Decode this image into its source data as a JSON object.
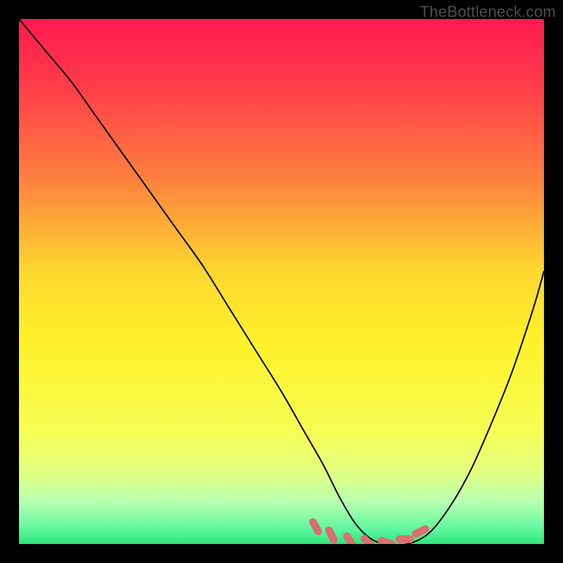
{
  "watermark": "TheBottleneck.com",
  "chart_data": {
    "type": "line",
    "title": "",
    "xlabel": "",
    "ylabel": "",
    "xlim": [
      0,
      100
    ],
    "ylim": [
      0,
      100
    ],
    "grid": false,
    "legend": false,
    "background_gradient": {
      "stops": [
        {
          "offset": 0,
          "color": "#ff1a4d"
        },
        {
          "offset": 12,
          "color": "#ff3a4a"
        },
        {
          "offset": 30,
          "color": "#fd7e3f"
        },
        {
          "offset": 48,
          "color": "#fdd72f"
        },
        {
          "offset": 62,
          "color": "#fef22a"
        },
        {
          "offset": 78,
          "color": "#f7fd52"
        },
        {
          "offset": 86,
          "color": "#e4ff7e"
        },
        {
          "offset": 92,
          "color": "#b7ffb0"
        },
        {
          "offset": 97,
          "color": "#63f7a0"
        },
        {
          "offset": 100,
          "color": "#2ee67a"
        }
      ]
    },
    "series": [
      {
        "name": "bottleneck-curve",
        "color": "#000000",
        "x": [
          0,
          5,
          10,
          15,
          20,
          25,
          30,
          35,
          40,
          45,
          50,
          54,
          58,
          61,
          64,
          67,
          70,
          74,
          78,
          82,
          86,
          90,
          94,
          98,
          100
        ],
        "values": [
          100,
          94,
          88,
          81,
          74,
          67,
          60,
          53,
          45,
          37,
          29,
          22,
          15,
          9,
          4,
          1,
          0,
          0,
          2,
          7,
          14,
          23,
          33,
          45,
          52
        ]
      },
      {
        "name": "bottom-markers",
        "type": "markers",
        "color": "#d87070",
        "x": [
          56.5,
          59.5,
          63.0,
          66.5,
          70.0,
          73.5,
          76.5
        ],
        "values": [
          3.3,
          1.7,
          0.6,
          0.3,
          0.3,
          0.9,
          2.4
        ]
      }
    ],
    "annotations": []
  }
}
